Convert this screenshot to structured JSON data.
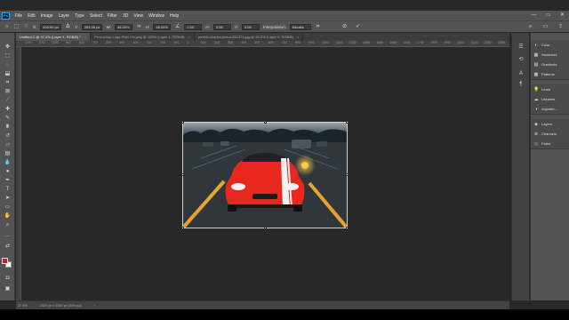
{
  "app": {
    "logo": "Ps"
  },
  "menu": [
    "File",
    "Edit",
    "Image",
    "Layer",
    "Type",
    "Select",
    "Filter",
    "3D",
    "View",
    "Window",
    "Help"
  ],
  "window_controls": {
    "minimize": "—",
    "maximize": "▭",
    "close": "✕"
  },
  "options": {
    "x_label": "X:",
    "x_value": "600.00 px",
    "y_label": "Y:",
    "y_value": "283.00 px",
    "w_label": "W:",
    "w_value": "46.00%",
    "h_label": "H:",
    "h_value": "46.00%",
    "angle_value": "0.00",
    "hskew_label": "H:",
    "hskew_value": "0.00",
    "vskew_label": "V:",
    "vskew_value": "0.00",
    "interpolation_label": "Interpolation:",
    "interpolation_value": "Bicubic"
  },
  "tabs": [
    {
      "label": "Untitled-1 @ 37.4% (Layer 1, RGB/8) *",
      "active": true
    },
    {
      "label": "Photoshop Logo PNG Pic.png @ 100% (Layer 1, RGB/8)",
      "active": false
    },
    {
      "label": "pexels-charles-kettor-811471.jpg @ 33.3% (Layer 0, RGB/8)",
      "active": false
    }
  ],
  "ruler_marks": [
    "1200",
    "1100",
    "1000",
    "900",
    "800",
    "700",
    "600",
    "500",
    "400",
    "300",
    "200",
    "100",
    "0",
    "100",
    "200",
    "300",
    "400",
    "500",
    "600",
    "700",
    "800",
    "900",
    "1000",
    "1100",
    "1200",
    "1300",
    "1400",
    "1500",
    "1600",
    "1700",
    "1800",
    "1900",
    "2000",
    "2100",
    "2200",
    "2300"
  ],
  "colors": {
    "foreground": "#c7221f",
    "background": "#ffffff",
    "workspace": "#282828",
    "car_red": "#e8281e",
    "lines": "#e8a32a"
  },
  "panels": {
    "group1": [
      {
        "icon": "color-icon",
        "label": "Color"
      },
      {
        "icon": "swatches-icon",
        "label": "Swatches"
      },
      {
        "icon": "gradients-icon",
        "label": "Gradients"
      },
      {
        "icon": "patterns-icon",
        "label": "Patterns"
      }
    ],
    "group2": [
      {
        "icon": "learn-icon",
        "label": "Learn"
      },
      {
        "icon": "libraries-icon",
        "label": "Libraries"
      },
      {
        "icon": "adjustments-icon",
        "label": "Adjustm..."
      }
    ],
    "group3": [
      {
        "icon": "layers-icon",
        "label": "Layers"
      },
      {
        "icon": "channels-icon",
        "label": "Channels"
      },
      {
        "icon": "paths-icon",
        "label": "Paths"
      }
    ]
  },
  "status": {
    "zoom": "37.4%",
    "doc_size": "1920 px x 1080 px (300 ppi)"
  }
}
